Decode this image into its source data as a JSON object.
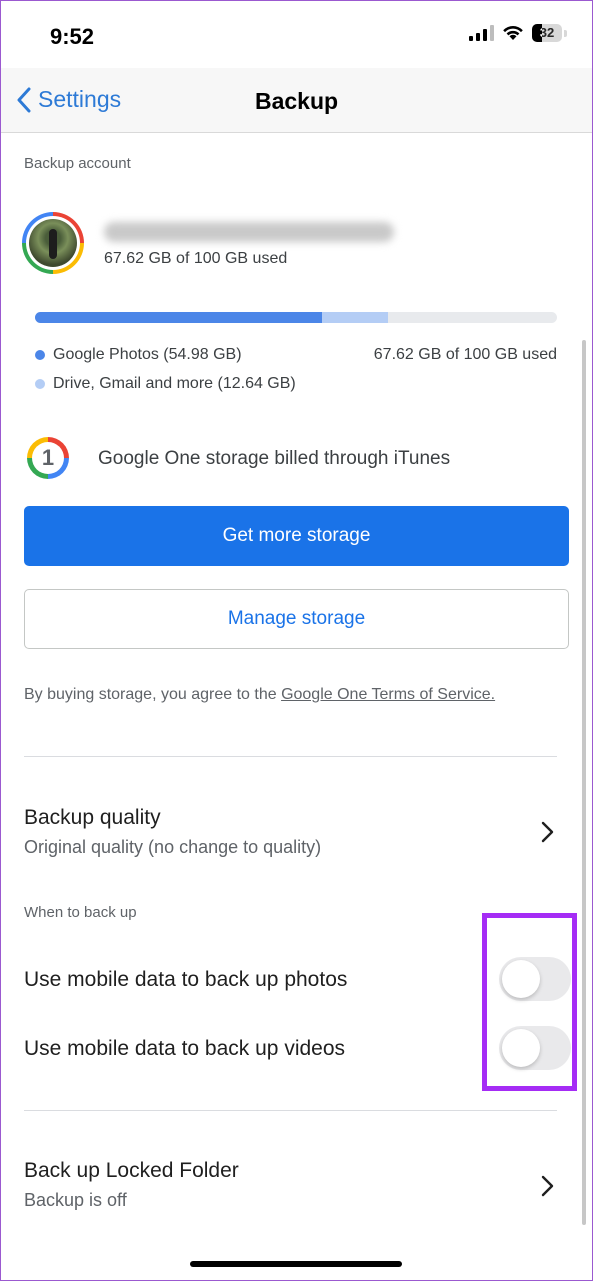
{
  "status_bar": {
    "time": "9:52",
    "battery": "32",
    "battery_fraction": 0.32
  },
  "nav": {
    "back_label": "Settings",
    "title": "Backup"
  },
  "backup_account": {
    "section_label": "Backup account",
    "usage": "67.62 GB of 100 GB used",
    "storage": {
      "photos_fraction": 0.5498,
      "other_fraction": 0.1264,
      "legend": [
        {
          "label": "Google Photos (54.98 GB)",
          "color": "#4b86e8"
        },
        {
          "label": "Drive, Gmail and more (12.64 GB)",
          "color": "#b4cdf5"
        }
      ],
      "total": "67.62 GB of 100 GB used"
    },
    "google_one_text": "Google One storage billed through iTunes",
    "get_more_label": "Get more storage",
    "manage_label": "Manage storage",
    "terms_prefix": "By buying storage, you agree to the ",
    "terms_link": "Google One Terms of Service."
  },
  "backup_quality": {
    "title": "Backup quality",
    "subtitle": "Original quality (no change to quality)"
  },
  "when_to_back_up": {
    "section_label": "When to back up",
    "photos_label": "Use mobile data to back up photos",
    "photos_enabled": false,
    "videos_label": "Use mobile data to back up videos",
    "videos_enabled": false
  },
  "locked_folder": {
    "title": "Back up Locked Folder",
    "subtitle": "Backup is off"
  },
  "colors": {
    "accent": "#1a73e8",
    "highlight": "#a52cf5"
  }
}
